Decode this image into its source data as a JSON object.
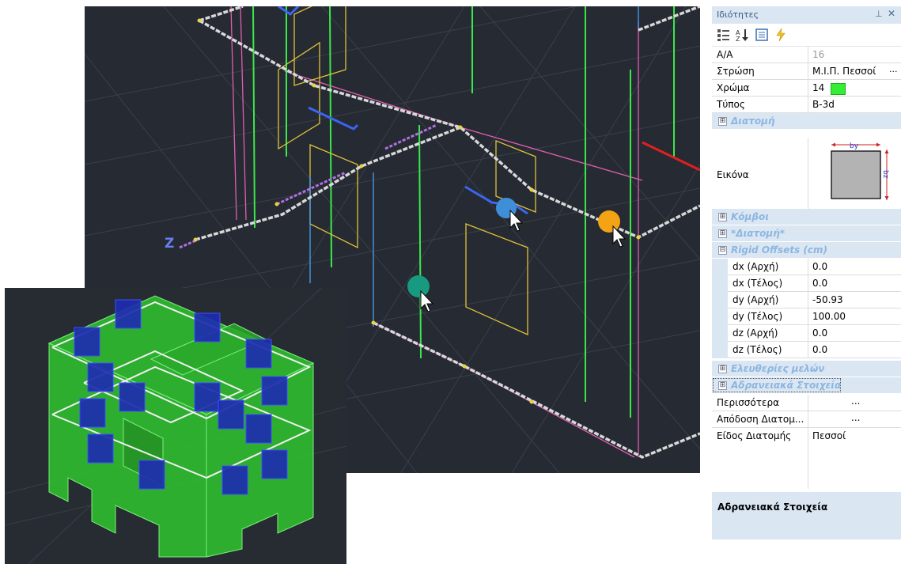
{
  "viewport": {
    "axis_label": "Z",
    "colors": {
      "background": "#262a33",
      "member": "#d8d8d8",
      "pink": "#e05fb0",
      "green": "#3be84a",
      "yellow": "#e0c23a",
      "blue": "#3a66f0",
      "cyan": "#4aa8ff",
      "purple": "#b070e0",
      "red": "#e02020"
    },
    "markers": [
      {
        "name": "blue-marker",
        "color": "#3f8fd8"
      },
      {
        "name": "orange-marker",
        "color": "#f4a314"
      },
      {
        "name": "teal-marker",
        "color": "#179a80"
      }
    ]
  },
  "inset": {
    "colors": {
      "background": "#272b32",
      "frame": "#2fc62f",
      "column": "#1e2bb0",
      "beam": "#f0f0f0"
    }
  },
  "panel": {
    "title": "Ιδιότητες",
    "pin_icon": "pin-icon",
    "close_icon": "close-icon",
    "toolbar": [
      "categorized-icon",
      "sort-az-icon",
      "property-pages-icon",
      "events-icon"
    ],
    "rows": {
      "aa": {
        "label": "A/A",
        "value": "16"
      },
      "layer": {
        "label": "Στρώση",
        "value": "Μ.Ι.Π. Πεσσοί",
        "button": "..."
      },
      "color": {
        "label": "Χρώμα",
        "value": "14",
        "swatch": "#33ee33"
      },
      "type": {
        "label": "Τύπος",
        "value": "B-3d"
      }
    },
    "cat_section": {
      "label": "Διατομή",
      "toggle": "⊞"
    },
    "image_row": {
      "label": "Εικόνα",
      "by": "by",
      "bz": "bz"
    },
    "cat_nodes": {
      "label": "Κόμβοι",
      "toggle": "⊞"
    },
    "cat_section2": {
      "label": "*Διατομή*",
      "toggle": "⊞"
    },
    "cat_rigid": {
      "label": "Rigid Offsets (cm)",
      "toggle": "⊟"
    },
    "offsets": [
      {
        "label": "dx (Αρχή)",
        "value": "0.0"
      },
      {
        "label": "dx (Τέλος)",
        "value": "0.0"
      },
      {
        "label": "dy (Αρχή)",
        "value": "-50.93"
      },
      {
        "label": "dy (Τέλος)",
        "value": "100.00"
      },
      {
        "label": "dz (Αρχή)",
        "value": "0.0"
      },
      {
        "label": "dz (Τέλος)",
        "value": "0.0"
      }
    ],
    "cat_releases": {
      "label": "Ελευθερίες μελών",
      "toggle": "⊞"
    },
    "cat_inertia": {
      "label": "Αδρανειακά Στοιχεία",
      "toggle": "⊞"
    },
    "more": {
      "label": "Περισσότερα",
      "button": "..."
    },
    "section_assign": {
      "label": "Απόδοση Διατομ...",
      "button": "..."
    },
    "section_kind": {
      "label": "Είδος Διατομής",
      "value": "Πεσσοί"
    },
    "description_title": "Αδρανειακά Στοιχεία"
  }
}
